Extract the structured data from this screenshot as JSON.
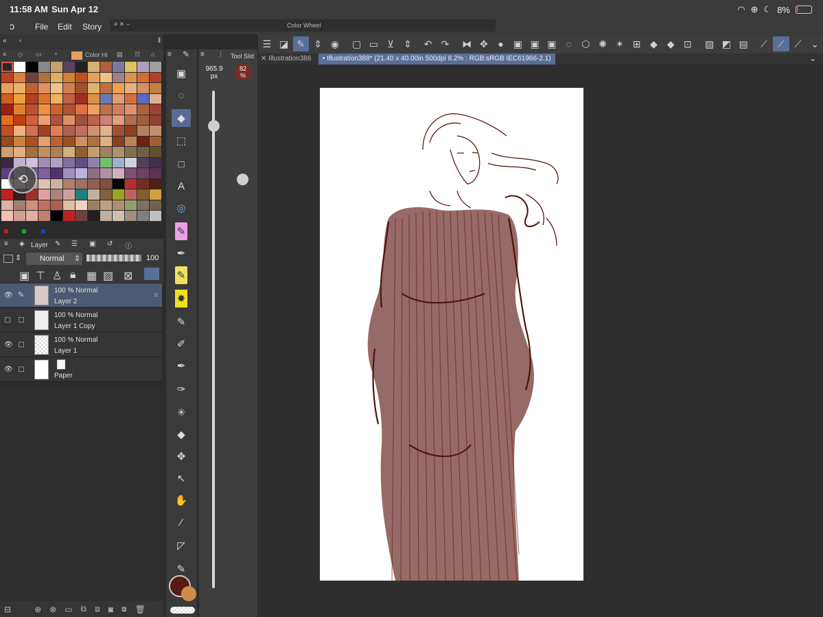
{
  "status": {
    "time": "11:58 AM",
    "date": "Sun Apr 12",
    "battery": "8%"
  },
  "menu": {
    "file": "File",
    "edit": "Edit",
    "story": "Story"
  },
  "color_wheel_title": "Color Wheel",
  "palette": {
    "tab_label": "Color Hi",
    "swatches": [
      "#2a2a2a",
      "#fff",
      "#000",
      "#888",
      "#c8a070",
      "#5a4060",
      "#222",
      "#d8b070",
      "#b06040",
      "#7a7aa0",
      "#e0c060",
      "#b0a0c0",
      "#a0a0a0",
      "#c04020",
      "#e08040",
      "#704040",
      "#b07040",
      "#e0b060",
      "#d08030",
      "#c05020",
      "#e0a060",
      "#f0c080",
      "#a08080",
      "#e09050",
      "#d07030",
      "#b04030",
      "#e8a060",
      "#f0b070",
      "#c06030",
      "#e09060",
      "#f0c090",
      "#d08050",
      "#a05030",
      "#e0b070",
      "#c07040",
      "#f0a050",
      "#e8b080",
      "#d09060",
      "#c08040",
      "#d06020",
      "#f0a040",
      "#b04020",
      "#e07030",
      "#f0b060",
      "#c06040",
      "#a03020",
      "#e09040",
      "#6a7ab0",
      "#e0a070",
      "#d07040",
      "#5a6ac0",
      "#e0b090",
      "#a02010",
      "#e08030",
      "#c05030",
      "#f09040",
      "#d06030",
      "#b05030",
      "#e07040",
      "#f0a060",
      "#c07050",
      "#d08060",
      "#e09070",
      "#b06040",
      "#a04030",
      "#e07020",
      "#c04010",
      "#d06040",
      "#f0a070",
      "#b05040",
      "#e09060",
      "#a05040",
      "#c06050",
      "#d08070",
      "#e0a080",
      "#b07050",
      "#a06040",
      "#904030",
      "#c05020",
      "#f0b080",
      "#d07050",
      "#a04020",
      "#e08050",
      "#b06050",
      "#c07060",
      "#d09070",
      "#e0b090",
      "#a05030",
      "#904020",
      "#b08060",
      "#c09070",
      "#9a4a1a",
      "#d08040",
      "#b05020",
      "#e0a070",
      "#c06030",
      "#a05020",
      "#d09060",
      "#b07040",
      "#e0b080",
      "#8a4020",
      "#c08050",
      "#702010",
      "#a06030",
      "#d0a070",
      "#e0b080",
      "#a07040",
      "#c09060",
      "#b08050",
      "#d0b080",
      "#906030",
      "#c0a070",
      "#a08060",
      "#b09070",
      "#807050",
      "#706040",
      "#605030",
      "#3a2a40",
      "#c0b0d0",
      "#d0c0e0",
      "#a090b0",
      "#b0a0c0",
      "#8070a0",
      "#605080",
      "#9080b0",
      "#70c070",
      "#a0b0d0",
      "#d0d0e0",
      "#504060",
      "#403050",
      "#604080",
      "#b0a0d0",
      "#706090",
      "#8060a0",
      "#503070",
      "#a090c0",
      "#c0b0e0",
      "#907080",
      "#b090a0",
      "#d0b0c0",
      "#805070",
      "#704060",
      "#603050",
      "#ffffff",
      "#f0e0e0",
      "#c09080",
      "#e0c0b0",
      "#d0b0a0",
      "#b08070",
      "#a07060",
      "#906050",
      "#805040",
      "#000000",
      "#b03030",
      "#703020",
      "#502010",
      "#c02020",
      "#302020",
      "#a03030",
      "#e0a0a0",
      "#b08080",
      "#d0a0a0",
      "#208080",
      "#c0b0a0",
      "#806040",
      "#a0a020",
      "#c06060",
      "#806030",
      "#d0a040",
      "#e0b0a0",
      "#a08070",
      "#d09080",
      "#c07060",
      "#b06050",
      "#e0c0a0",
      "#f0d0c0",
      "#a08060",
      "#c0a080",
      "#b09070",
      "#90a070",
      "#807060",
      "#706050",
      "#f0c0b0",
      "#d0a090",
      "#e0b0a0",
      "#c08070",
      "#000",
      "#c02020",
      "#704040",
      "#202020",
      "#c0b0a0",
      "#d0c0b0",
      "#a09080",
      "#808080",
      "#c0c0c0"
    ]
  },
  "layer_panel": {
    "tab_label": "Layer",
    "blend_mode": "Normal",
    "opacity_value": "100",
    "layers": [
      {
        "opacity": "100 %",
        "mode": "Normal",
        "name": "Layer 2",
        "selected": true,
        "visible": true
      },
      {
        "opacity": "100 %",
        "mode": "Normal",
        "name": "Layer 1 Copy",
        "selected": false,
        "visible": false
      },
      {
        "opacity": "100 %",
        "mode": "Normal",
        "name": "Layer 1",
        "selected": false,
        "visible": true
      },
      {
        "opacity": "",
        "mode": "",
        "name": "Paper",
        "selected": false,
        "visible": true
      }
    ]
  },
  "tool_slider": {
    "tab_label": "Tool Slid",
    "size_value": "965.9",
    "size_unit": "px",
    "opacity_value": "82",
    "opacity_unit": "%"
  },
  "colors": {
    "main": "#5a1a14",
    "sub": "#d08a4a",
    "accent": "#596b93"
  },
  "documents": {
    "tabs": [
      {
        "label": "Illustration386",
        "active": false
      },
      {
        "label": "Illustration388* (21.40 x 40.00in 500dpi 8.2% : RGB:sRGB IEC61966-2.1)",
        "active": true
      }
    ]
  }
}
